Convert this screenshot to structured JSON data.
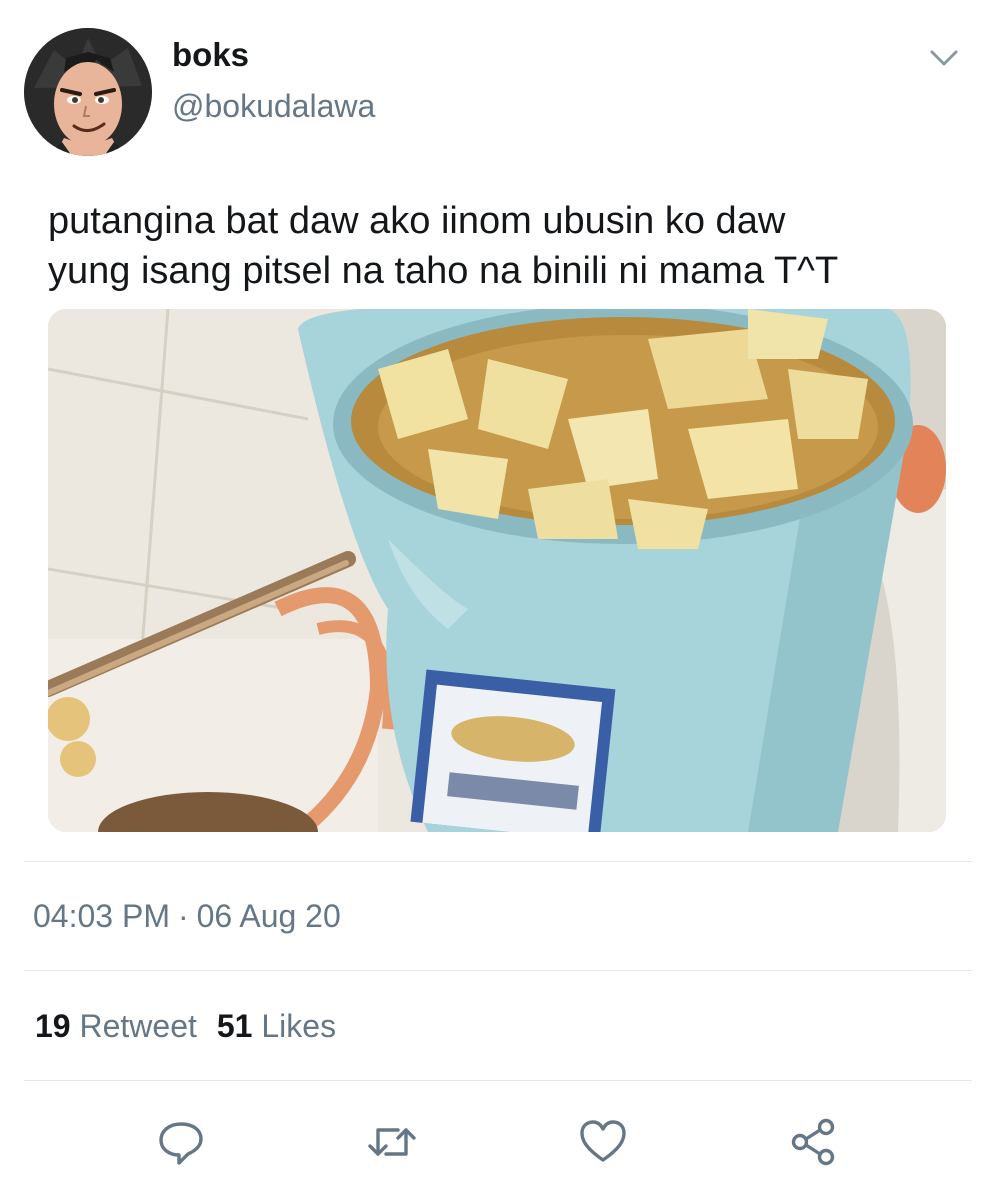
{
  "user": {
    "display_name": "boks",
    "handle": "@bokudalawa"
  },
  "tweet": {
    "text": "putangina bat daw ako iinom ubusin ko daw\nyung isang pitsel na taho na binili ni mama T^T",
    "time": "04:03 PM",
    "separator": "·",
    "date": "06 Aug 20"
  },
  "stats": {
    "retweet_count": "19",
    "retweet_label": "Retweet",
    "like_count": "51",
    "like_label": "Likes"
  },
  "icons": {
    "menu": "chevron-down-icon",
    "reply": "reply-icon",
    "retweet": "retweet-icon",
    "like": "heart-icon",
    "share": "share-icon"
  },
  "colors": {
    "text": "#14171a",
    "secondary": "#657786",
    "divider": "#e1e8ed",
    "icon": "#657786"
  }
}
